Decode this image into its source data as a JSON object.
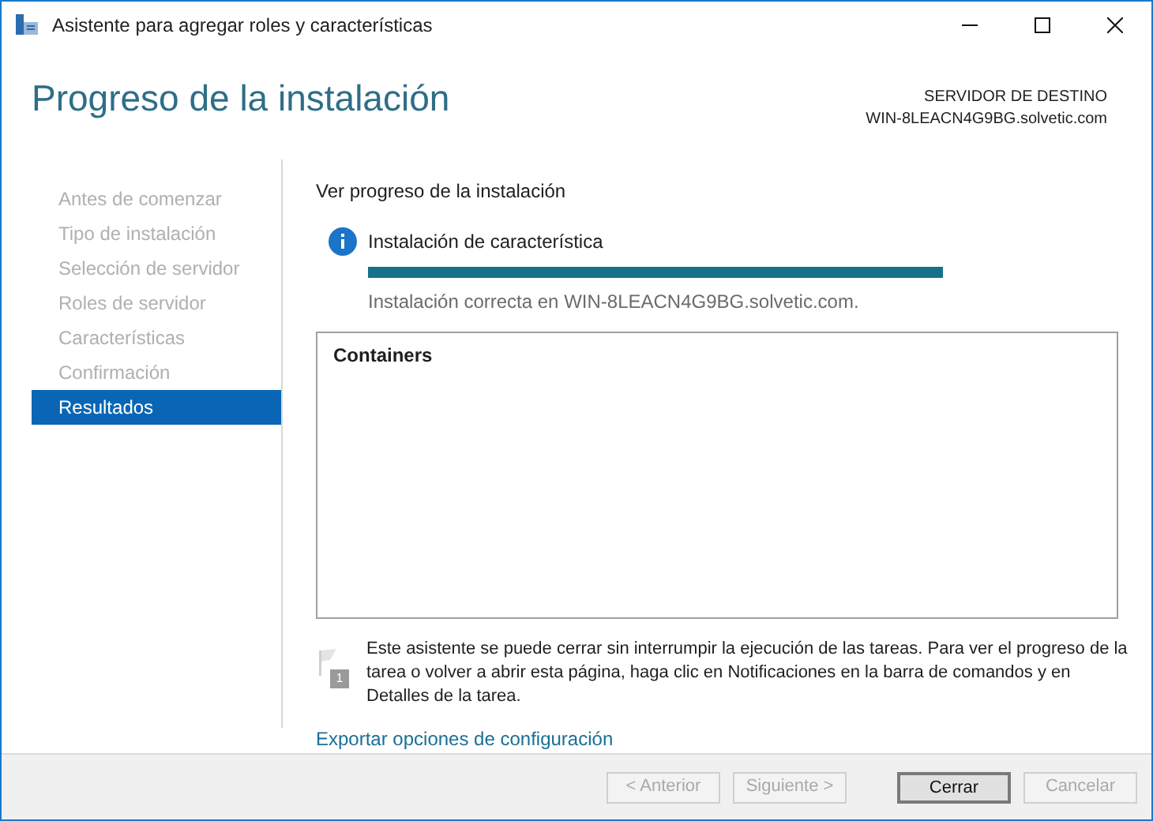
{
  "window": {
    "title": "Asistente para agregar roles y características"
  },
  "header": {
    "title": "Progreso de la instalación",
    "server_label": "SERVIDOR DE DESTINO",
    "server_name": "WIN-8LEACN4G9BG.solvetic.com"
  },
  "sidebar": {
    "items": [
      {
        "label": "Antes de comenzar",
        "selected": false
      },
      {
        "label": "Tipo de instalación",
        "selected": false
      },
      {
        "label": "Selección de servidor",
        "selected": false
      },
      {
        "label": "Roles de servidor",
        "selected": false
      },
      {
        "label": "Características",
        "selected": false
      },
      {
        "label": "Confirmación",
        "selected": false
      },
      {
        "label": "Resultados",
        "selected": true
      }
    ]
  },
  "content": {
    "heading": "Ver progreso de la instalación",
    "status": {
      "title": "Instalación de característica",
      "level": 1,
      "message": "Instalación correcta en WIN-8LEACN4G9BG.solvetic.com."
    },
    "results": [
      "Containers"
    ],
    "note_badge": "1",
    "note": "Este asistente se puede cerrar sin interrumpir la ejecución de las tareas. Para ver el progreso de la tarea o volver a abrir esta página, haga clic en Notificaciones en la barra de comandos y en Detalles de la tarea.",
    "export_link": "Exportar opciones de configuración"
  },
  "buttons": [
    {
      "label": "< Anterior",
      "disabled": true,
      "default": false
    },
    {
      "label": "Siguiente >",
      "disabled": true,
      "default": false
    },
    {
      "label": "Cerrar",
      "disabled": false,
      "default": true
    },
    {
      "label": "Cancelar",
      "disabled": true,
      "default": false
    }
  ]
}
